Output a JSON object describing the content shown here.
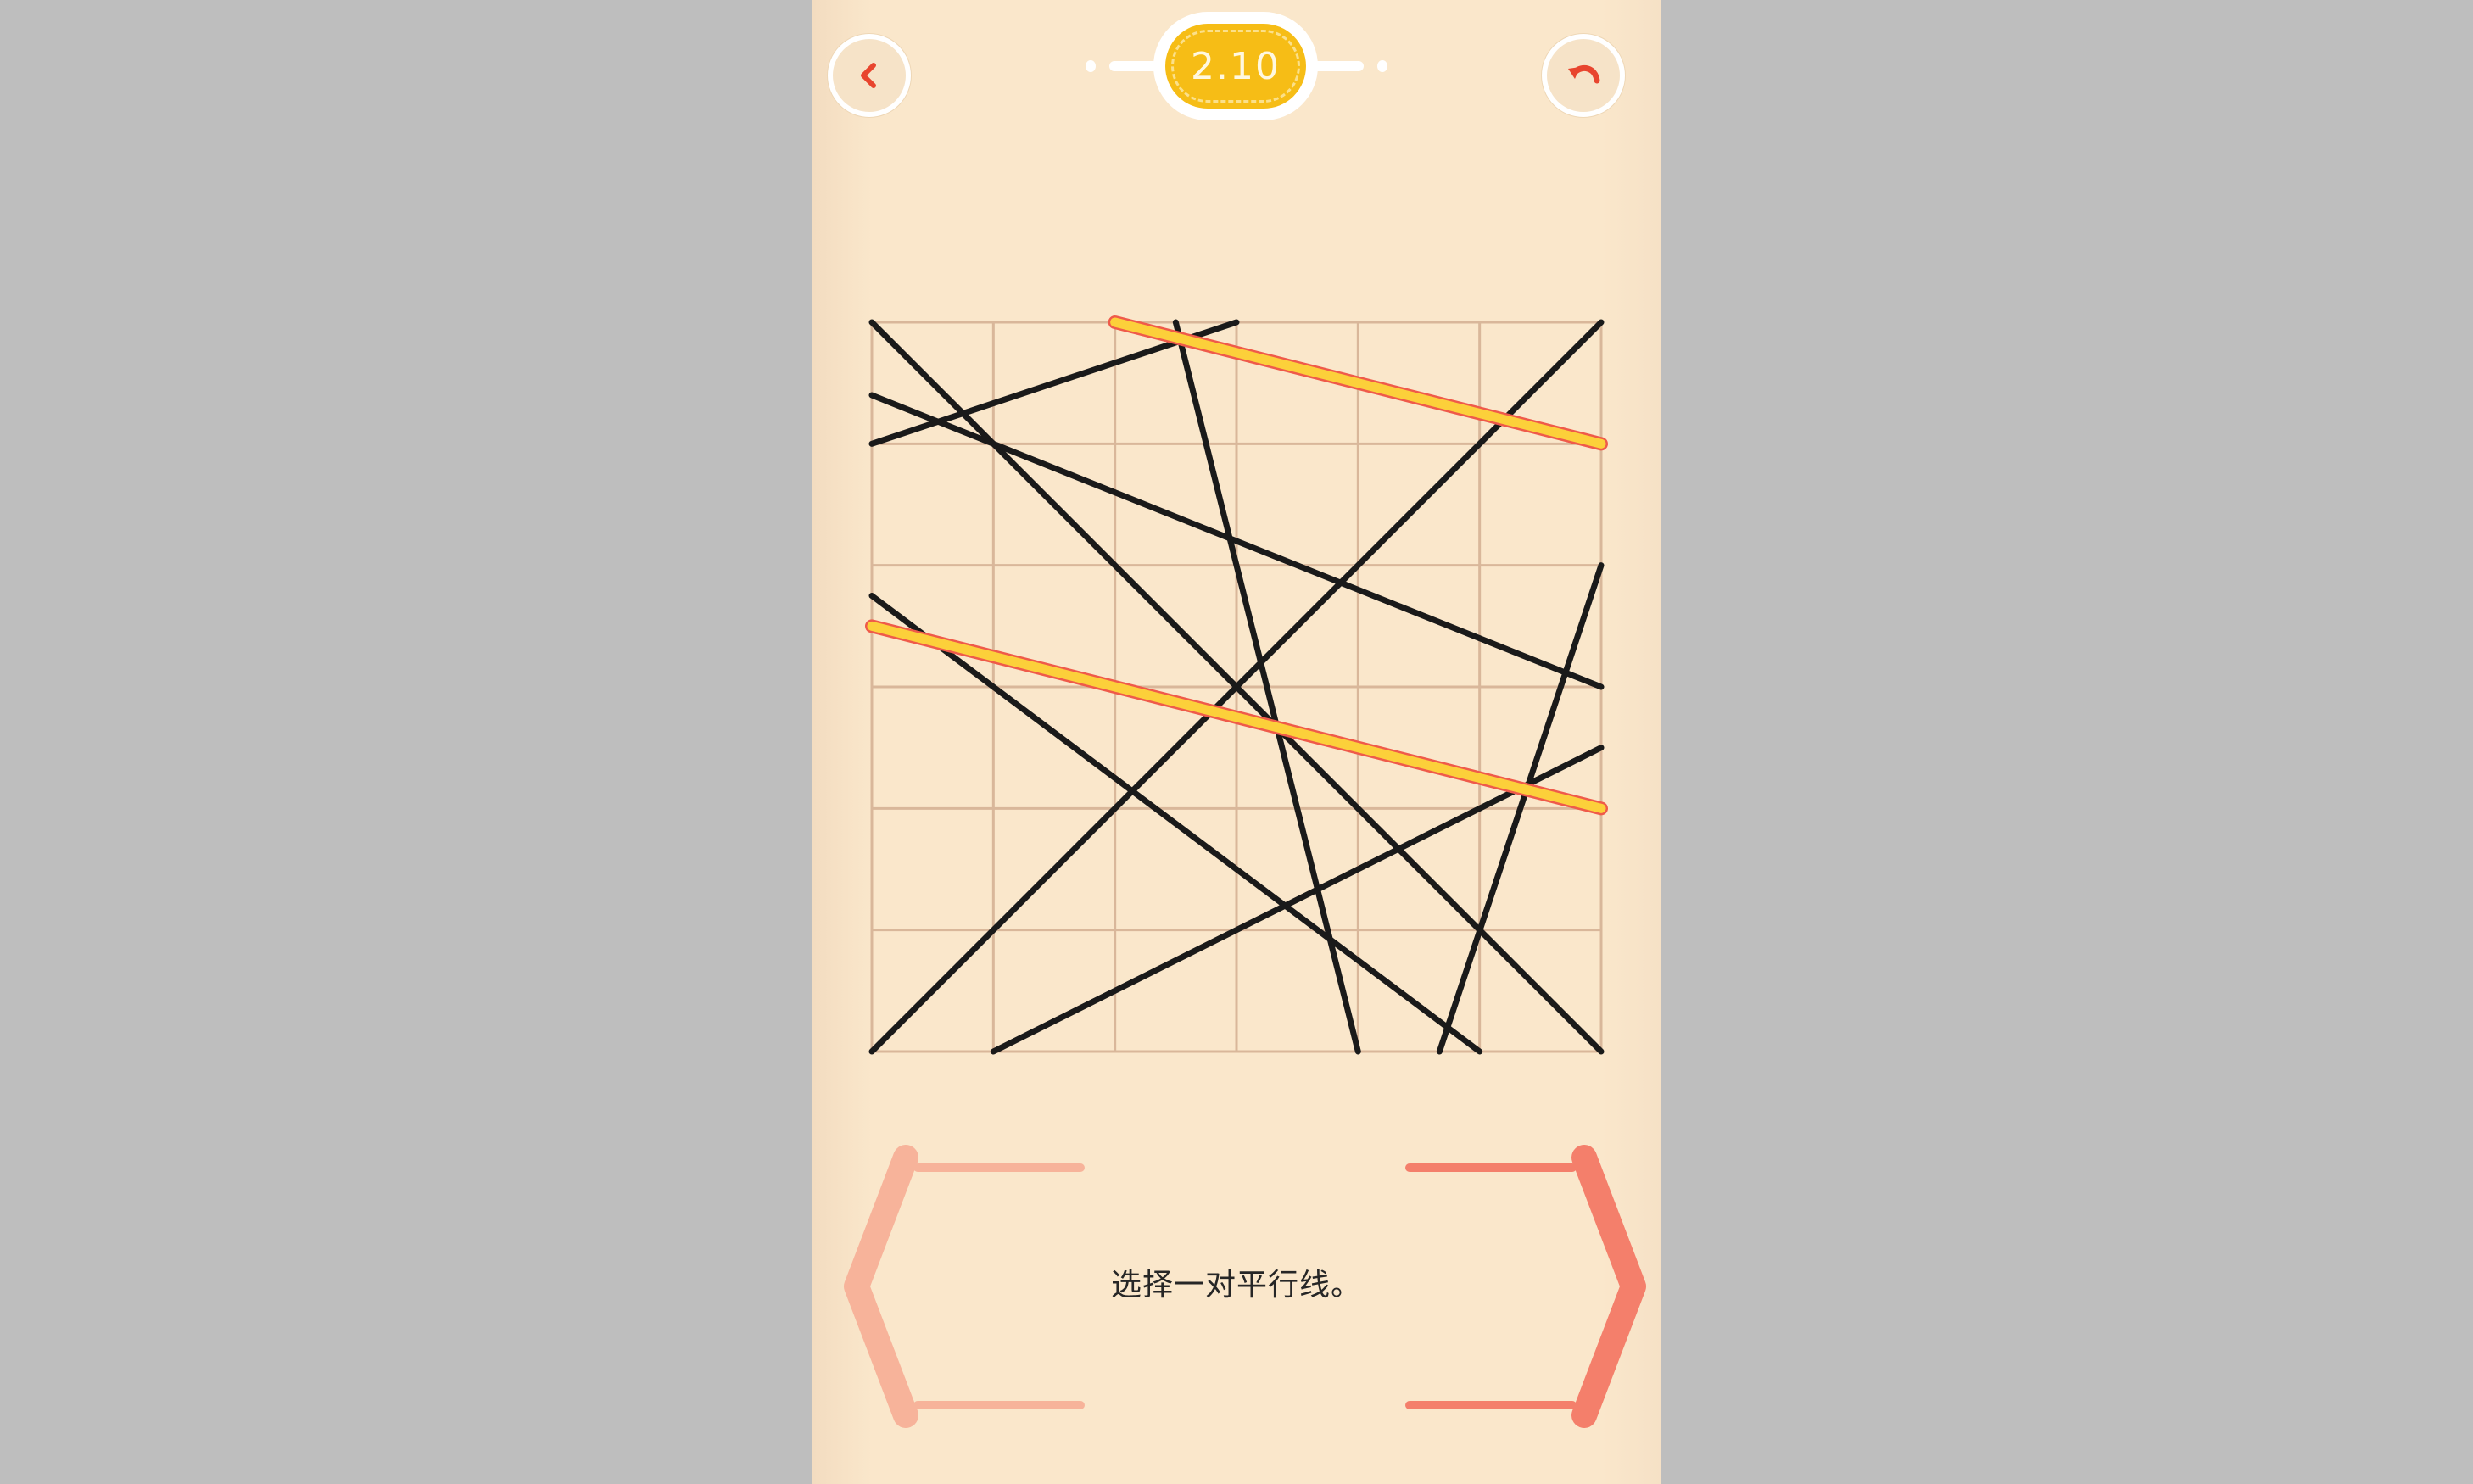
{
  "header": {
    "back_icon": "chevron-left-icon",
    "undo_icon": "undo-icon",
    "level": "2.10",
    "accent_color": "#f6bd16",
    "icon_color": "#e8452e"
  },
  "puzzle": {
    "grid_cells": 6,
    "line_color": "#1a1a1a",
    "highlight_color": "#fcd03a",
    "highlight_outline": "#ef5a4a",
    "lines": [
      {
        "from": [
          0,
          0
        ],
        "to": [
          6,
          6
        ],
        "selected": false
      },
      {
        "from": [
          0,
          6
        ],
        "to": [
          6,
          0
        ],
        "selected": false
      },
      {
        "from": [
          0,
          1
        ],
        "to": [
          3,
          0
        ],
        "selected": false
      },
      {
        "from": [
          0,
          0.6
        ],
        "to": [
          6,
          3
        ],
        "selected": false
      },
      {
        "from": [
          2.5,
          0
        ],
        "to": [
          4,
          6
        ],
        "selected": false
      },
      {
        "from": [
          0,
          2.25
        ],
        "to": [
          5,
          6
        ],
        "selected": false
      },
      {
        "from": [
          1,
          6
        ],
        "to": [
          6,
          3.5
        ],
        "selected": false
      },
      {
        "from": [
          4.67,
          6
        ],
        "to": [
          6,
          2
        ],
        "selected": false
      },
      {
        "from": [
          2,
          0
        ],
        "to": [
          6,
          1
        ],
        "selected": true
      },
      {
        "from": [
          0,
          2.5
        ],
        "to": [
          6,
          4
        ],
        "selected": true
      }
    ]
  },
  "instruction": "选择一对平行线。",
  "nav": {
    "prev_icon": "bracket-left-icon",
    "next_icon": "bracket-right-icon",
    "prev_color": "#f7b39a",
    "next_color": "#f47f6b"
  }
}
